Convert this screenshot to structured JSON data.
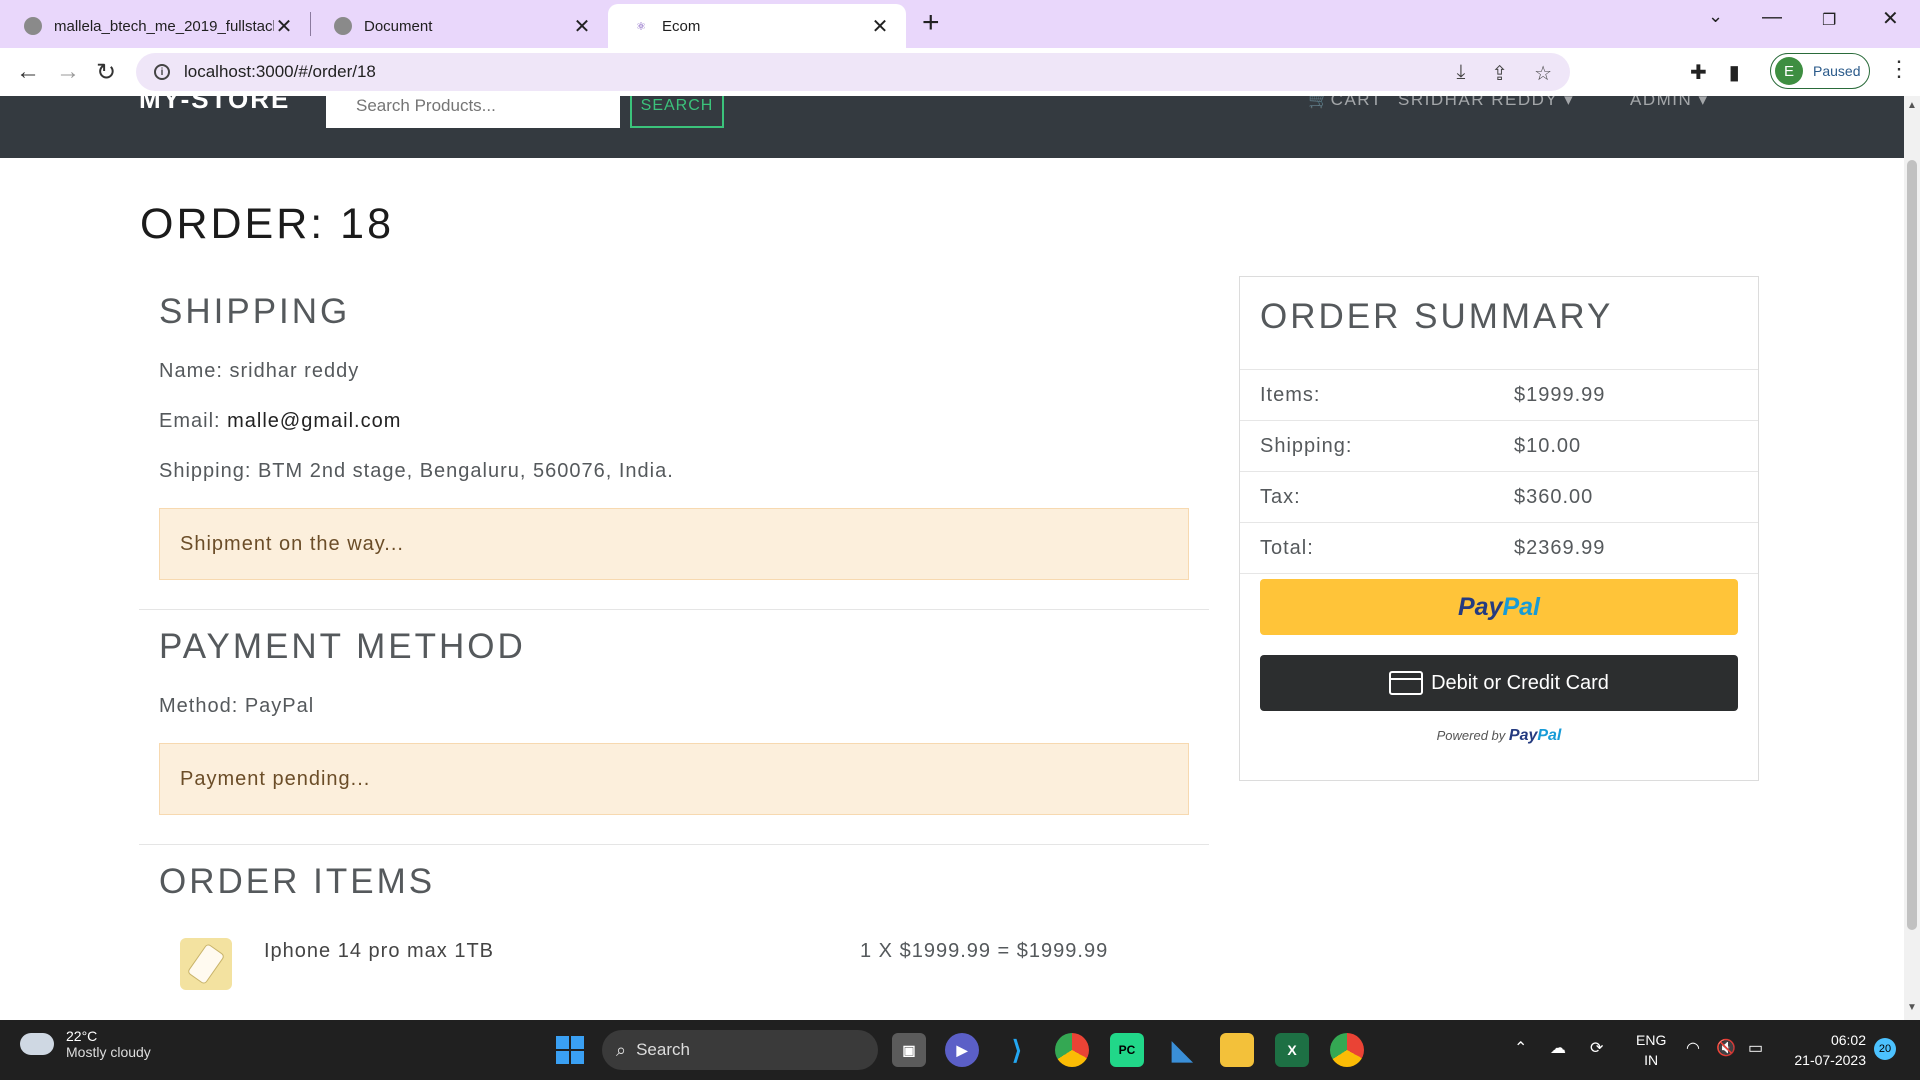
{
  "browser": {
    "tabs": [
      {
        "title": "mallela_btech_me_2019_fullstack",
        "close": "✕"
      },
      {
        "title": "Document",
        "close": "✕"
      },
      {
        "title": "Ecom",
        "close": "✕"
      }
    ],
    "new_tab": "+",
    "window_controls": {
      "minimize": "—",
      "restore": "❐",
      "close": "✕",
      "dropdown": "⌄"
    },
    "url": "localhost:3000/#/order/18",
    "profile_initial": "E",
    "profile_status": "Paused"
  },
  "navbar": {
    "brand": "MY-STORE",
    "search_placeholder": "Search Products...",
    "search_button": "SEARCH",
    "cart": "CART",
    "user": "SRIDHAR REDDY",
    "admin": "ADMIN"
  },
  "order": {
    "title": "ORDER: 18",
    "shipping": {
      "heading": "SHIPPING",
      "name_label": "Name:",
      "name_value": "sridhar reddy",
      "email_label": "Email:",
      "email_value": "malle@gmail.com",
      "address_label": "Shipping:",
      "address_value": "BTM 2nd stage, Bengaluru, 560076, India.",
      "status": "Shipment on the way..."
    },
    "payment": {
      "heading": "PAYMENT METHOD",
      "method_label": "Method:",
      "method_value": "PayPal",
      "status": "Payment pending..."
    },
    "items": {
      "heading": "ORDER ITEMS",
      "list": [
        {
          "name": "Iphone 14 pro max 1TB",
          "calc": "1 X $1999.99 = $1999.99"
        }
      ]
    }
  },
  "summary": {
    "heading": "ORDER SUMMARY",
    "rows": [
      {
        "label": "Items:",
        "value": "$1999.99"
      },
      {
        "label": "Shipping:",
        "value": "$10.00"
      },
      {
        "label": "Tax:",
        "value": "$360.00"
      },
      {
        "label": "Total:",
        "value": "$2369.99"
      }
    ],
    "paypal_pay": "Pay",
    "paypal_pal": "Pal",
    "card_button": "Debit or Credit Card",
    "powered_by": "Powered by",
    "powered_pay": "Pay",
    "powered_pal": "Pal"
  },
  "taskbar": {
    "temperature": "22°C",
    "weather": "Mostly cloudy",
    "search": "Search",
    "lang_1": "ENG",
    "lang_2": "IN",
    "time": "06:02",
    "date": "21-07-2023",
    "notifications": "20"
  },
  "colors": {
    "navbar": "#343a40",
    "accent_green": "#3bc37b",
    "alert_bg": "#fcefdc",
    "paypal_yellow": "#ffc439",
    "card_dark": "#2c2e2f"
  }
}
